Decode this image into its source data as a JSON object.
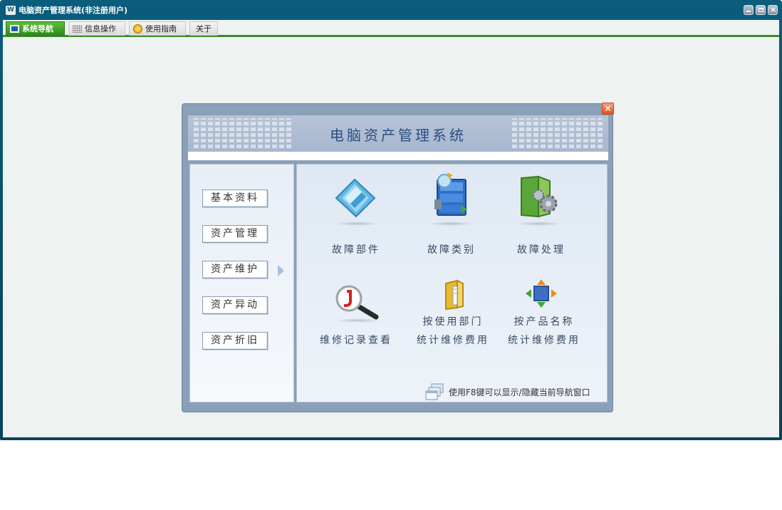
{
  "window": {
    "title": "电脑资产管理系统(非注册用户)",
    "icon": "app-logo-icon",
    "icon_glyph": "W"
  },
  "tabs": [
    {
      "label": "系统导航",
      "icon": "monitor-icon",
      "active": true
    },
    {
      "label": "信息操作",
      "icon": "grid-icon"
    },
    {
      "label": "使用指南",
      "icon": "smiley-icon"
    },
    {
      "label": "关于"
    }
  ],
  "navigator": {
    "title": "电脑资产管理系统",
    "close_glyph": "×",
    "categories": [
      "基本资料",
      "资产管理",
      "资产维护",
      "资产异动",
      "资产折旧"
    ],
    "active_category": "资产维护",
    "functions": [
      {
        "label": "故障部件",
        "icon": "diamond-part-icon"
      },
      {
        "label": "故障类别",
        "icon": "cabinet-icon"
      },
      {
        "label": "故障处理",
        "icon": "folder-gear-icon"
      },
      {
        "label": "维修记录查看",
        "icon": "magnifier-icon"
      },
      {
        "label_lines": [
          "按使用部门",
          "统计维修费用"
        ],
        "icon": "book-folder-icon"
      },
      {
        "label_lines": [
          "按产品名称",
          "统计维修费用"
        ],
        "icon": "arrows-cube-icon"
      }
    ],
    "hint": "使用F8键可以显示/隐藏当前导航窗口"
  },
  "colors": {
    "titlebar": "#0b5d7c",
    "tab_active": "#3b8a2a",
    "panel_frame": "#8aa0b8",
    "title_text": "#2c4e7e"
  }
}
